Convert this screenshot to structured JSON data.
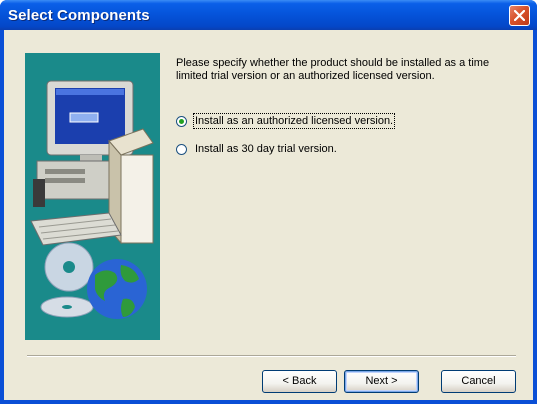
{
  "window": {
    "title": "Select Components"
  },
  "description": "Please specify whether the product should be installed as a time limited trial version or an authorized licensed version.",
  "options": [
    {
      "label": "Install as an authorized licensed version.",
      "selected": true
    },
    {
      "label": "Install as 30 day trial version.",
      "selected": false
    }
  ],
  "buttons": {
    "back": "< Back",
    "next": "Next >",
    "cancel": "Cancel"
  },
  "colors": {
    "titlebar": "#0553d9",
    "dialog_background": "#ece9d8",
    "art_panel": "#1a8a8a",
    "close_button": "#d8532c"
  },
  "icons": {
    "close": "close-icon",
    "art": "computer-cd-globe-illustration"
  }
}
